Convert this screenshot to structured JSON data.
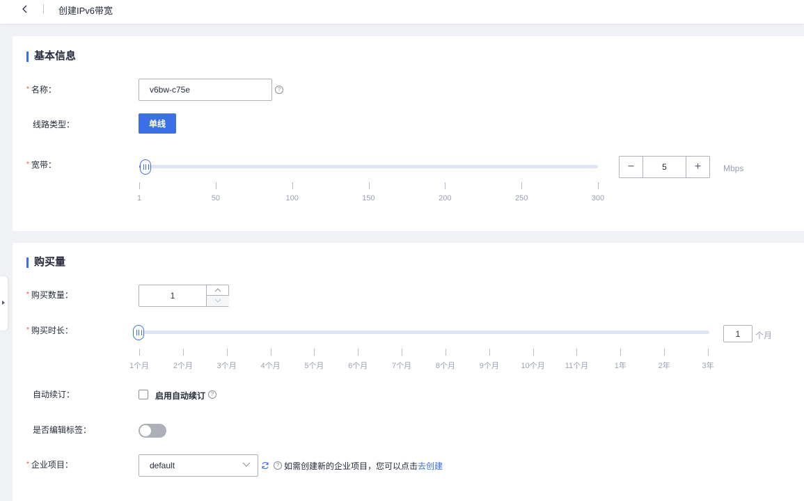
{
  "header": {
    "title": "创建IPv6带宽"
  },
  "basic": {
    "section_title": "基本信息",
    "name_label": "名称：",
    "name_value": "v6bw-c75e",
    "line_label": "线路类型：",
    "line_button": "单线",
    "bw_label": "宽带：",
    "bw_value": 5,
    "bw_value_text": "5",
    "bw_unit": "Mbps",
    "bw_min": 1,
    "bw_max": 300,
    "bw_ticks": [
      "1",
      "50",
      "100",
      "150",
      "200",
      "250",
      "300"
    ],
    "bw_dec": "−",
    "bw_inc": "+"
  },
  "purchase": {
    "section_title": "购买量",
    "qty_label": "购买数量：",
    "qty_value": "1",
    "dur_label": "购买时长：",
    "dur_value": "1",
    "dur_unit": "个月",
    "dur_fraction": 0,
    "dur_ticks": [
      "1个月",
      "2个月",
      "3个月",
      "4个月",
      "5个月",
      "6个月",
      "7个月",
      "8个月",
      "9个月",
      "10个月",
      "11个月",
      "1年",
      "2年",
      "3年"
    ],
    "auto_label": "自动续订：",
    "auto_check_label": "启用自动续订",
    "auto_checked": false,
    "tag_label": "是否编辑标签：",
    "tag_enabled": false,
    "ent_label": "企业项目：",
    "ent_value": "default",
    "ent_hint": "如需创建新的企业项目，您可以点击",
    "ent_link": "去创建"
  },
  "colors": {
    "accent": "#3b6fe6",
    "required": "#e5533c"
  }
}
